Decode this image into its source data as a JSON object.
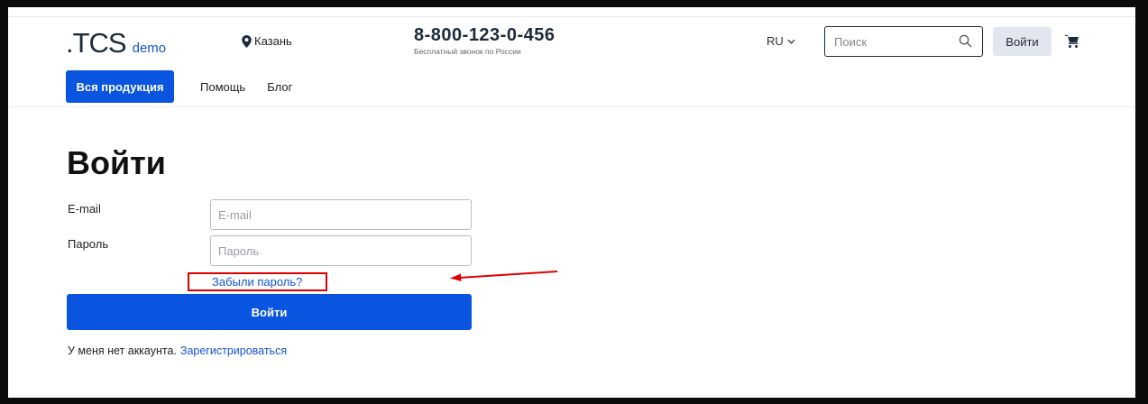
{
  "header": {
    "logo_mark": ".TCS",
    "logo_demo": "demo",
    "city": "Казань",
    "phone_number": "8-800-123-0-456",
    "phone_caption": "Бесплатный звонок по России",
    "language": "RU",
    "search_placeholder": "Поиск",
    "login_label": "Войти"
  },
  "nav": {
    "primary": "Вся продукция",
    "links": [
      "Помощь",
      "Блог"
    ]
  },
  "login_form": {
    "title": "Войти",
    "email_label": "E-mail",
    "email_placeholder": "E-mail",
    "email_value": "",
    "password_label": "Пароль",
    "password_placeholder": "Пароль",
    "password_value": "",
    "forgot_link": "Забыли пароль?",
    "submit_label": "Войти",
    "no_account_text": "У меня нет аккаунта.",
    "register_link": "Зарегистрироваться"
  },
  "annotation": {
    "highlight_color": "#e00000",
    "arrow_color": "#e00000"
  },
  "colors": {
    "accent": "#0a55e0",
    "link": "#1553d6",
    "dark_text": "#1d2a3c"
  },
  "icons": {
    "city": "location-pin-icon",
    "language": "chevron-down-icon",
    "search": "search-icon",
    "cart": "cart-icon"
  }
}
